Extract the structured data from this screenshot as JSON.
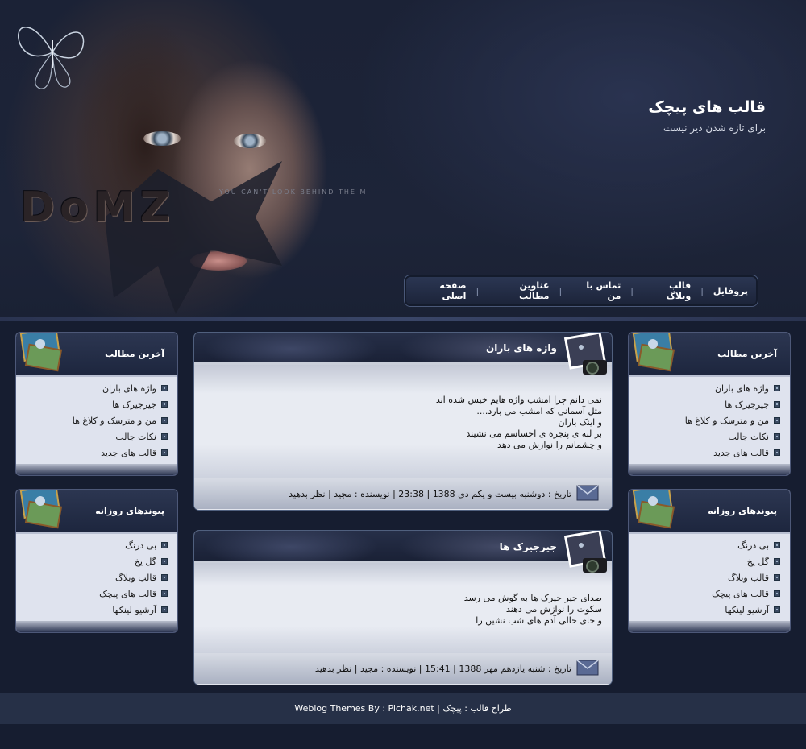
{
  "site": {
    "title": "قالب های پیچک",
    "description": "برای تازه شدن دیر نیست",
    "art_text": "DoMZ",
    "art_sub": "YOU CAN'T LOOK BEHIND THE M"
  },
  "nav": {
    "items": [
      "صفحه اصلی",
      "عناوین مطالب",
      "تماس با من",
      "قالب وبلاگ",
      "پروفایل"
    ],
    "separator": "|"
  },
  "sidebar_left": {
    "latest": {
      "title": "آخرین مطالب",
      "links": [
        "واژه های باران",
        "جیرجیرک ها",
        "من و مترسک و کلاغ ها",
        "نکات جالب",
        "قالب های جدید"
      ]
    },
    "daily_links": {
      "title": "پیوندهای روزانه",
      "links": [
        "بی درنگ",
        "گل یخ",
        "قالب وبلاگ",
        "قالب های پیچک",
        "آرشیو لینکها"
      ]
    }
  },
  "sidebar_right": {
    "latest": {
      "title": "آخرین مطالب",
      "links": [
        "واژه های باران",
        "جیرجیرک ها",
        "من و مترسک و کلاغ ها",
        "نکات جالب",
        "قالب های جدید"
      ]
    },
    "daily_links": {
      "title": "پیوندهای روزانه",
      "links": [
        "بی درنگ",
        "گل یخ",
        "قالب وبلاگ",
        "قالب های پیچک",
        "آرشیو لینکها"
      ]
    }
  },
  "posts": [
    {
      "title": "واژه های باران",
      "lines": [
        "نمی دانم چرا امشب واژه هایم خیس شده اند",
        "مثل آسمانی که امشب می بارد....",
        "و اینک باران",
        "بر لبه ی پنجره ی احساسم می نشیند",
        "و چشمانم را نوازش می دهد"
      ],
      "date": "تاریخ : دوشنبه بیست و یکم دی 1388",
      "time": "23:38",
      "author": "نویسنده : مجید",
      "comment": "نظر بدهید"
    },
    {
      "title": "جیرجیرک ها",
      "lines": [
        "صدای جیر جیرک ها به گوش می رسد",
        "سکوت را نوازش می دهند",
        "و جای خالی آدم های شب نشین را"
      ],
      "date": "تاریخ : شنبه یازدهم مهر 1388",
      "time": "15:41",
      "author": "نویسنده : مجید",
      "comment": "نظر بدهید"
    }
  ],
  "footer": {
    "text": "طراح قالب : پیچک | Weblog Themes By : Pichak.net"
  }
}
